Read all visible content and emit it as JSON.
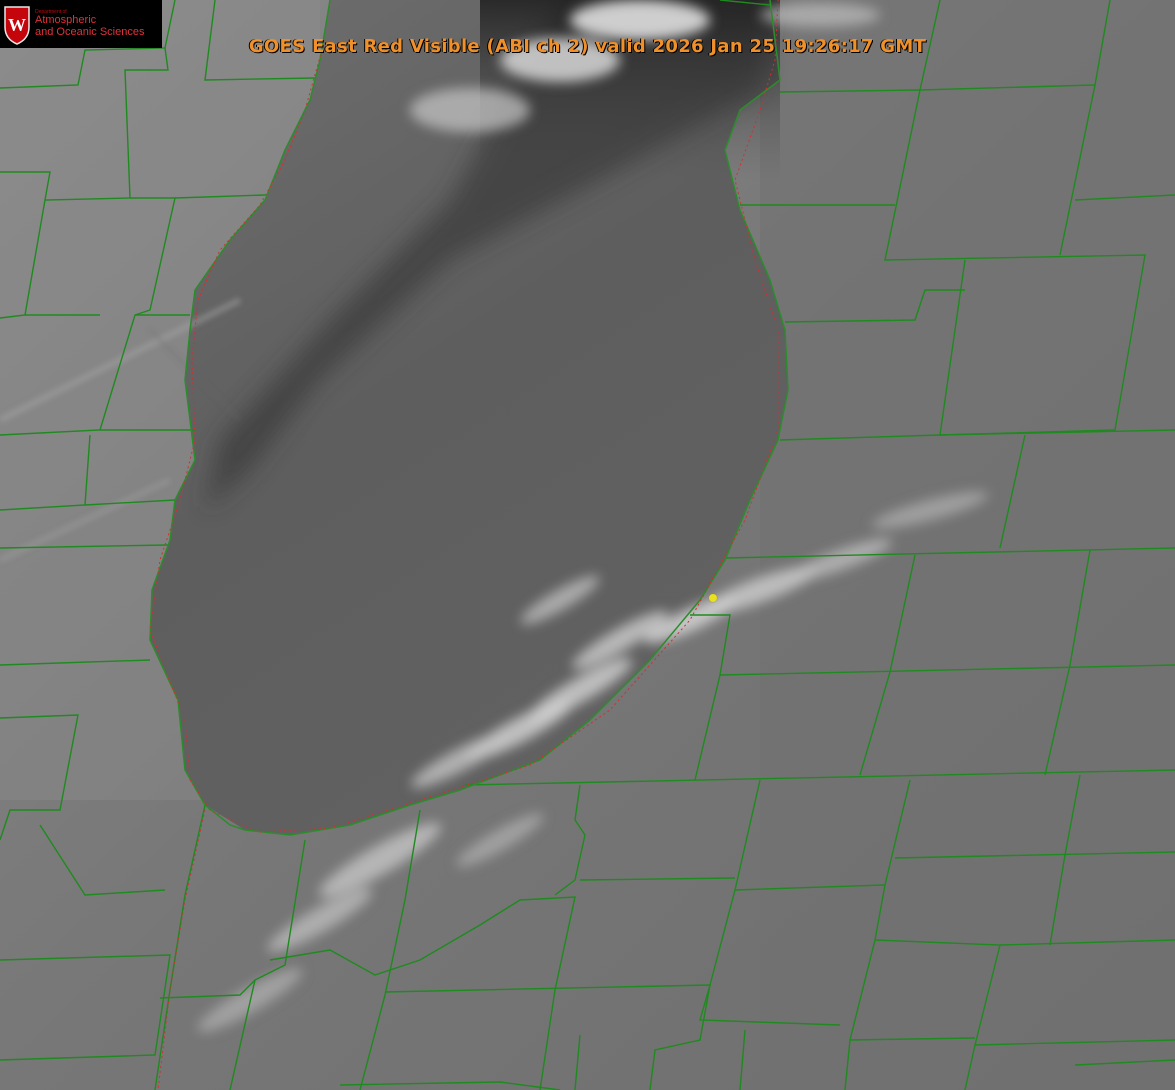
{
  "logo": {
    "department_small": "Department of",
    "line1": "Atmospheric",
    "line2": "and Oceanic Sciences",
    "crest_letter": "W",
    "colors": {
      "crest": "#c5050c",
      "text": "#e0323a"
    }
  },
  "title": "GOES East Red Visible (ABI ch 2) valid 2026 Jan 25 19:26:17 GMT",
  "colors": {
    "title": "#f0902a",
    "county_lines": "#1f8a1f",
    "shoreline": "#2c8c2c",
    "shoreline_dotted": "#d03030",
    "site_marker": "#e8e020"
  },
  "layers": {
    "imagery": "visible-satellite-grayscale",
    "overlays": [
      "county-boundaries",
      "lake-shoreline",
      "state-boundary-dotted",
      "site-marker"
    ]
  }
}
